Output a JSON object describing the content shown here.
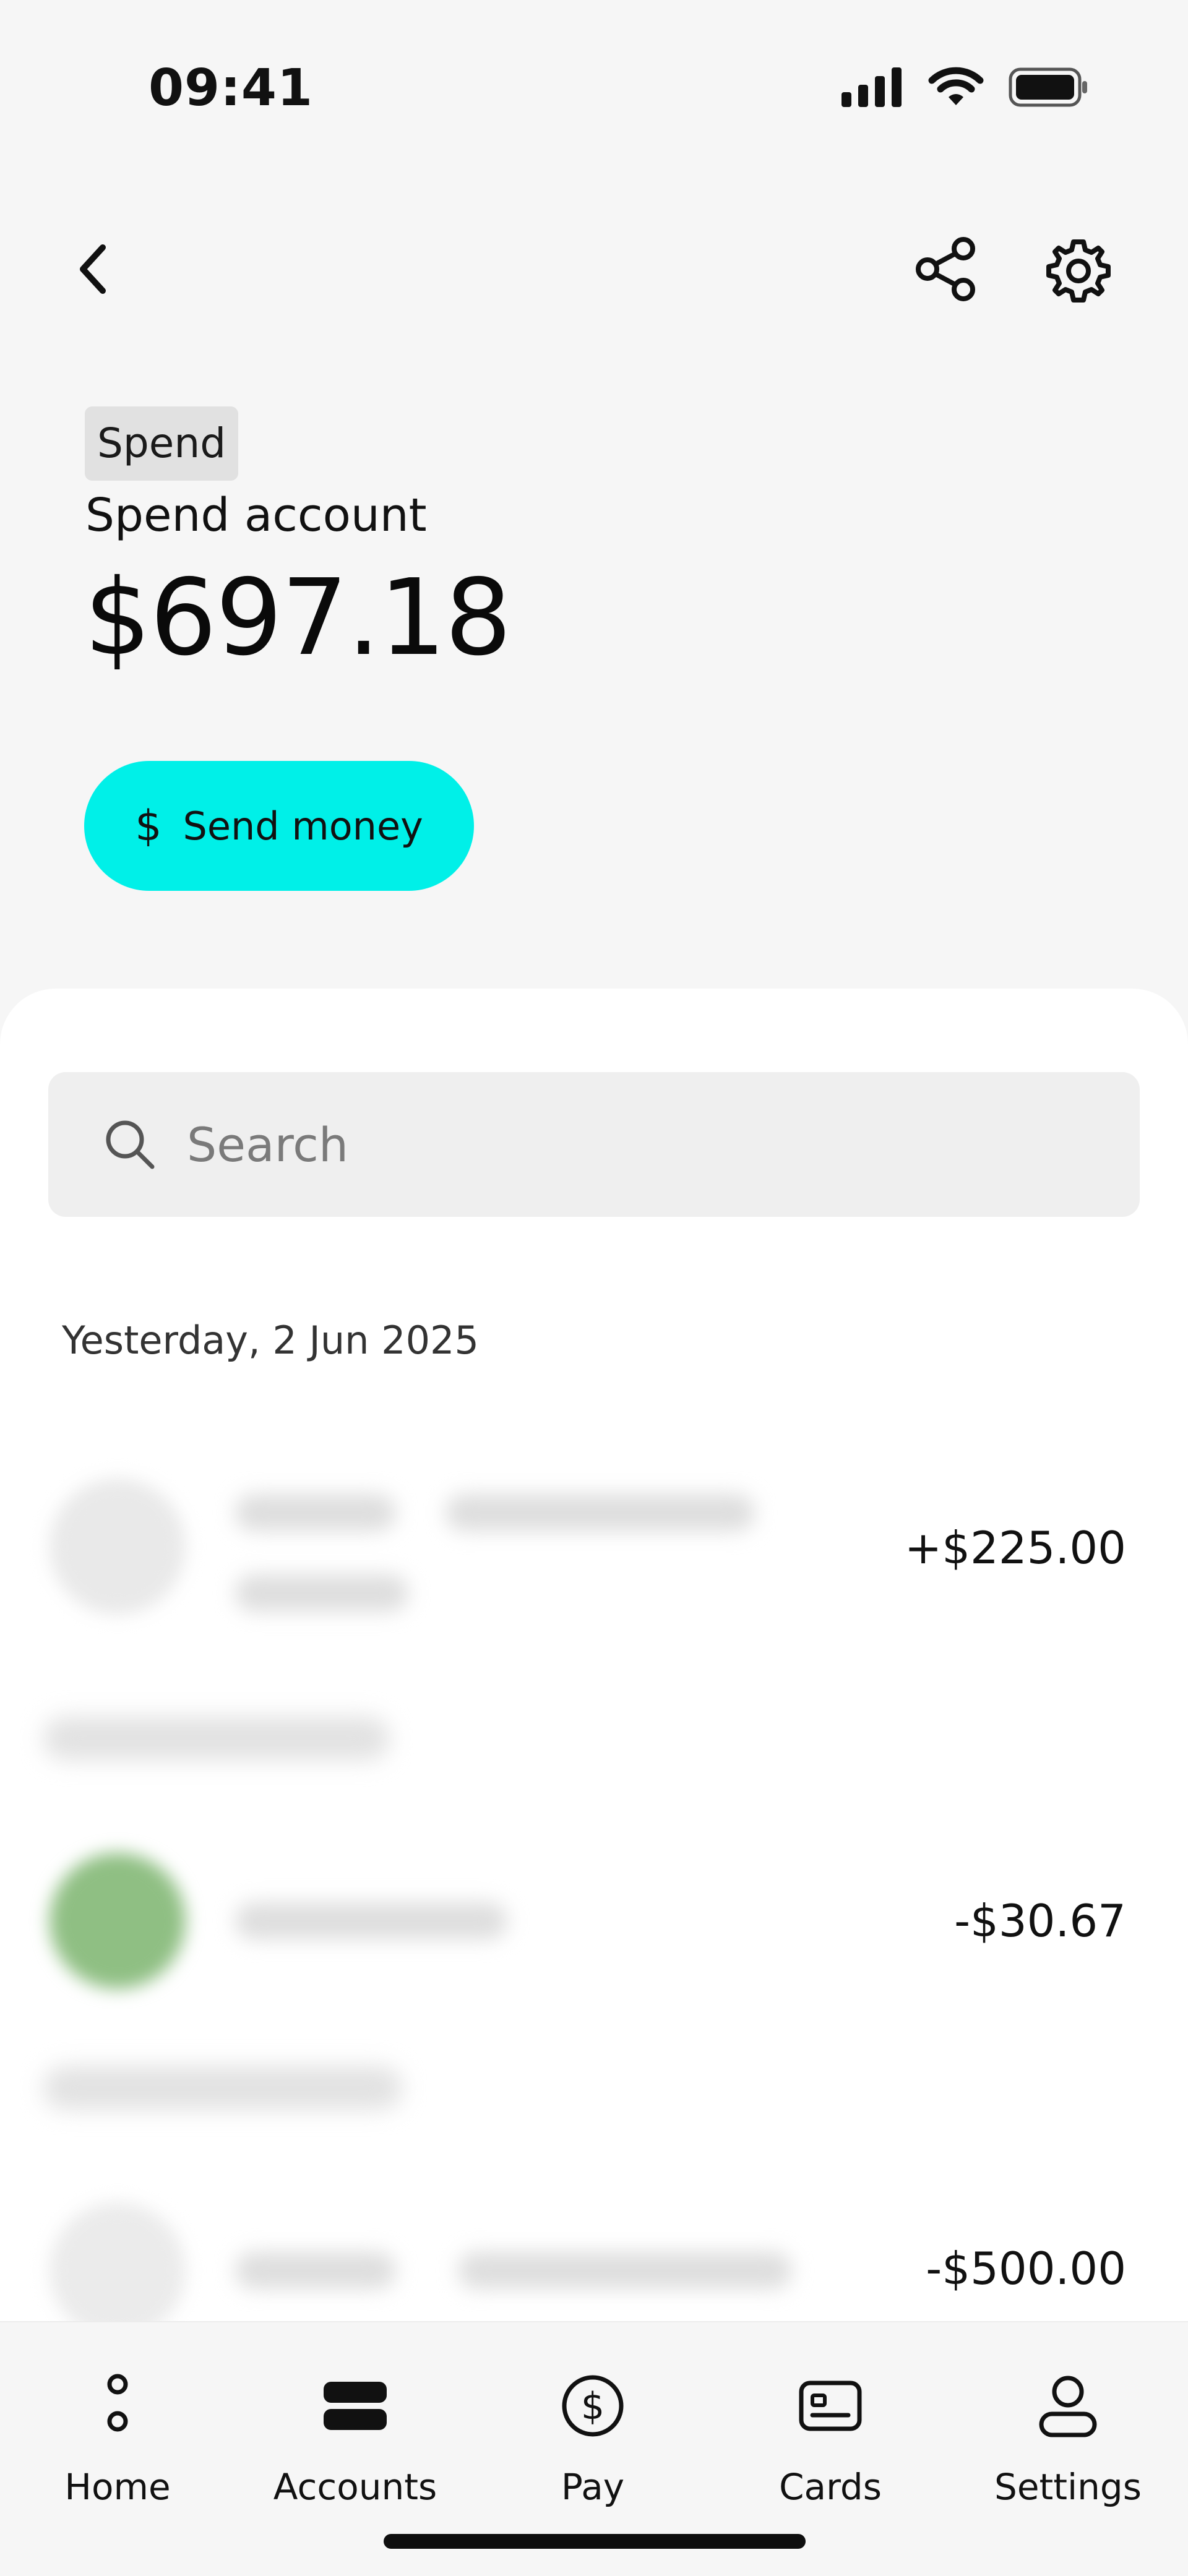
{
  "status_bar": {
    "time": "09:41"
  },
  "account": {
    "tag": "Spend",
    "name": "Spend account",
    "balance": "$697.18",
    "send_button_label": "Send money",
    "send_button_icon": "$"
  },
  "search": {
    "placeholder": "Search"
  },
  "transactions": {
    "date_header": "Yesterday, 2 Jun 2025",
    "items": [
      {
        "amount": "+$225.00"
      },
      {
        "amount": "-$30.67"
      },
      {
        "amount": "-$500.00"
      }
    ]
  },
  "tabs": [
    {
      "label": "Home",
      "icon": "home-icon"
    },
    {
      "label": "Accounts",
      "icon": "accounts-icon"
    },
    {
      "label": "Pay",
      "icon": "pay-icon"
    },
    {
      "label": "Cards",
      "icon": "cards-icon"
    },
    {
      "label": "Settings",
      "icon": "settings-profile-icon"
    }
  ],
  "colors": {
    "accent": "#00f0e8",
    "background": "#f6f6f6",
    "sheet": "#ffffff",
    "merchant_green": "#8fbf83"
  }
}
